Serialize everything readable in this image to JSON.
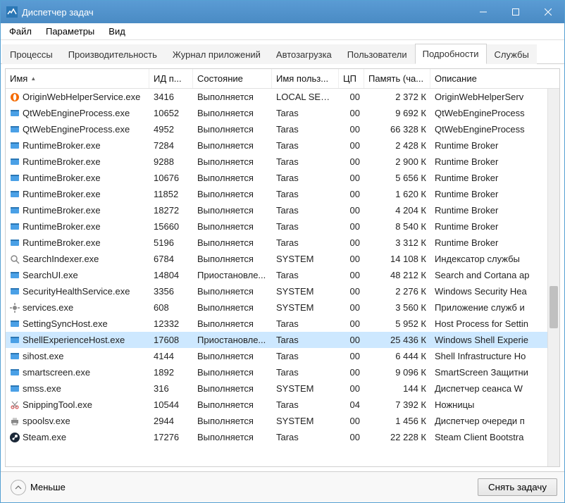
{
  "window": {
    "title": "Диспетчер задач"
  },
  "menubar": {
    "items": [
      {
        "label": "Файл"
      },
      {
        "label": "Параметры"
      },
      {
        "label": "Вид"
      }
    ]
  },
  "tabs": [
    {
      "label": "Процессы",
      "active": false
    },
    {
      "label": "Производительность",
      "active": false
    },
    {
      "label": "Журнал приложений",
      "active": false
    },
    {
      "label": "Автозагрузка",
      "active": false
    },
    {
      "label": "Пользователи",
      "active": false
    },
    {
      "label": "Подробности",
      "active": true
    },
    {
      "label": "Службы",
      "active": false
    }
  ],
  "columns": [
    {
      "label": "Имя",
      "sorted": true
    },
    {
      "label": "ИД п..."
    },
    {
      "label": "Состояние"
    },
    {
      "label": "Имя польз..."
    },
    {
      "label": "ЦП"
    },
    {
      "label": "Память (ча..."
    },
    {
      "label": "Описание"
    }
  ],
  "processes": [
    {
      "icon": "origin",
      "name": "OriginWebHelperService.exe",
      "pid": "3416",
      "state": "Выполняется",
      "user": "LOCAL SER...",
      "cpu": "00",
      "mem": "2 372 К",
      "desc": "OriginWebHelperServ",
      "selected": false
    },
    {
      "icon": "app",
      "name": "QtWebEngineProcess.exe",
      "pid": "10652",
      "state": "Выполняется",
      "user": "Taras",
      "cpu": "00",
      "mem": "9 692 К",
      "desc": "QtWebEngineProcess",
      "selected": false
    },
    {
      "icon": "app",
      "name": "QtWebEngineProcess.exe",
      "pid": "4952",
      "state": "Выполняется",
      "user": "Taras",
      "cpu": "00",
      "mem": "66 328 К",
      "desc": "QtWebEngineProcess",
      "selected": false
    },
    {
      "icon": "app",
      "name": "RuntimeBroker.exe",
      "pid": "7284",
      "state": "Выполняется",
      "user": "Taras",
      "cpu": "00",
      "mem": "2 428 К",
      "desc": "Runtime Broker",
      "selected": false
    },
    {
      "icon": "app",
      "name": "RuntimeBroker.exe",
      "pid": "9288",
      "state": "Выполняется",
      "user": "Taras",
      "cpu": "00",
      "mem": "2 900 К",
      "desc": "Runtime Broker",
      "selected": false
    },
    {
      "icon": "app",
      "name": "RuntimeBroker.exe",
      "pid": "10676",
      "state": "Выполняется",
      "user": "Taras",
      "cpu": "00",
      "mem": "5 656 К",
      "desc": "Runtime Broker",
      "selected": false
    },
    {
      "icon": "app",
      "name": "RuntimeBroker.exe",
      "pid": "11852",
      "state": "Выполняется",
      "user": "Taras",
      "cpu": "00",
      "mem": "1 620 К",
      "desc": "Runtime Broker",
      "selected": false
    },
    {
      "icon": "app",
      "name": "RuntimeBroker.exe",
      "pid": "18272",
      "state": "Выполняется",
      "user": "Taras",
      "cpu": "00",
      "mem": "4 204 К",
      "desc": "Runtime Broker",
      "selected": false
    },
    {
      "icon": "app",
      "name": "RuntimeBroker.exe",
      "pid": "15660",
      "state": "Выполняется",
      "user": "Taras",
      "cpu": "00",
      "mem": "8 540 К",
      "desc": "Runtime Broker",
      "selected": false
    },
    {
      "icon": "app",
      "name": "RuntimeBroker.exe",
      "pid": "5196",
      "state": "Выполняется",
      "user": "Taras",
      "cpu": "00",
      "mem": "3 312 К",
      "desc": "Runtime Broker",
      "selected": false
    },
    {
      "icon": "search",
      "name": "SearchIndexer.exe",
      "pid": "6784",
      "state": "Выполняется",
      "user": "SYSTEM",
      "cpu": "00",
      "mem": "14 108 К",
      "desc": "Индексатор службы",
      "selected": false
    },
    {
      "icon": "app",
      "name": "SearchUI.exe",
      "pid": "14804",
      "state": "Приостановле...",
      "user": "Taras",
      "cpu": "00",
      "mem": "48 212 К",
      "desc": "Search and Cortana ap",
      "selected": false
    },
    {
      "icon": "app",
      "name": "SecurityHealthService.exe",
      "pid": "3356",
      "state": "Выполняется",
      "user": "SYSTEM",
      "cpu": "00",
      "mem": "2 276 К",
      "desc": "Windows Security Hea",
      "selected": false
    },
    {
      "icon": "gear",
      "name": "services.exe",
      "pid": "608",
      "state": "Выполняется",
      "user": "SYSTEM",
      "cpu": "00",
      "mem": "3 560 К",
      "desc": "Приложение служб и",
      "selected": false
    },
    {
      "icon": "app",
      "name": "SettingSyncHost.exe",
      "pid": "12332",
      "state": "Выполняется",
      "user": "Taras",
      "cpu": "00",
      "mem": "5 952 К",
      "desc": "Host Process for Settin",
      "selected": false
    },
    {
      "icon": "app",
      "name": "ShellExperienceHost.exe",
      "pid": "17608",
      "state": "Приостановле...",
      "user": "Taras",
      "cpu": "00",
      "mem": "25 436 К",
      "desc": "Windows Shell Experie",
      "selected": true
    },
    {
      "icon": "app",
      "name": "sihost.exe",
      "pid": "4144",
      "state": "Выполняется",
      "user": "Taras",
      "cpu": "00",
      "mem": "6 444 К",
      "desc": "Shell Infrastructure Ho",
      "selected": false
    },
    {
      "icon": "app",
      "name": "smartscreen.exe",
      "pid": "1892",
      "state": "Выполняется",
      "user": "Taras",
      "cpu": "00",
      "mem": "9 096 К",
      "desc": "SmartScreen Защитни",
      "selected": false
    },
    {
      "icon": "app",
      "name": "smss.exe",
      "pid": "316",
      "state": "Выполняется",
      "user": "SYSTEM",
      "cpu": "00",
      "mem": "144 К",
      "desc": "Диспетчер сеанса W",
      "selected": false
    },
    {
      "icon": "snip",
      "name": "SnippingTool.exe",
      "pid": "10544",
      "state": "Выполняется",
      "user": "Taras",
      "cpu": "04",
      "mem": "7 392 К",
      "desc": "Ножницы",
      "selected": false
    },
    {
      "icon": "printer",
      "name": "spoolsv.exe",
      "pid": "2944",
      "state": "Выполняется",
      "user": "SYSTEM",
      "cpu": "00",
      "mem": "1 456 К",
      "desc": "Диспетчер очереди п",
      "selected": false
    },
    {
      "icon": "steam",
      "name": "Steam.exe",
      "pid": "17276",
      "state": "Выполняется",
      "user": "Taras",
      "cpu": "00",
      "mem": "22 228 К",
      "desc": "Steam Client Bootstra",
      "selected": false
    }
  ],
  "footer": {
    "less_label": "Меньше",
    "end_task_label": "Снять задачу"
  }
}
